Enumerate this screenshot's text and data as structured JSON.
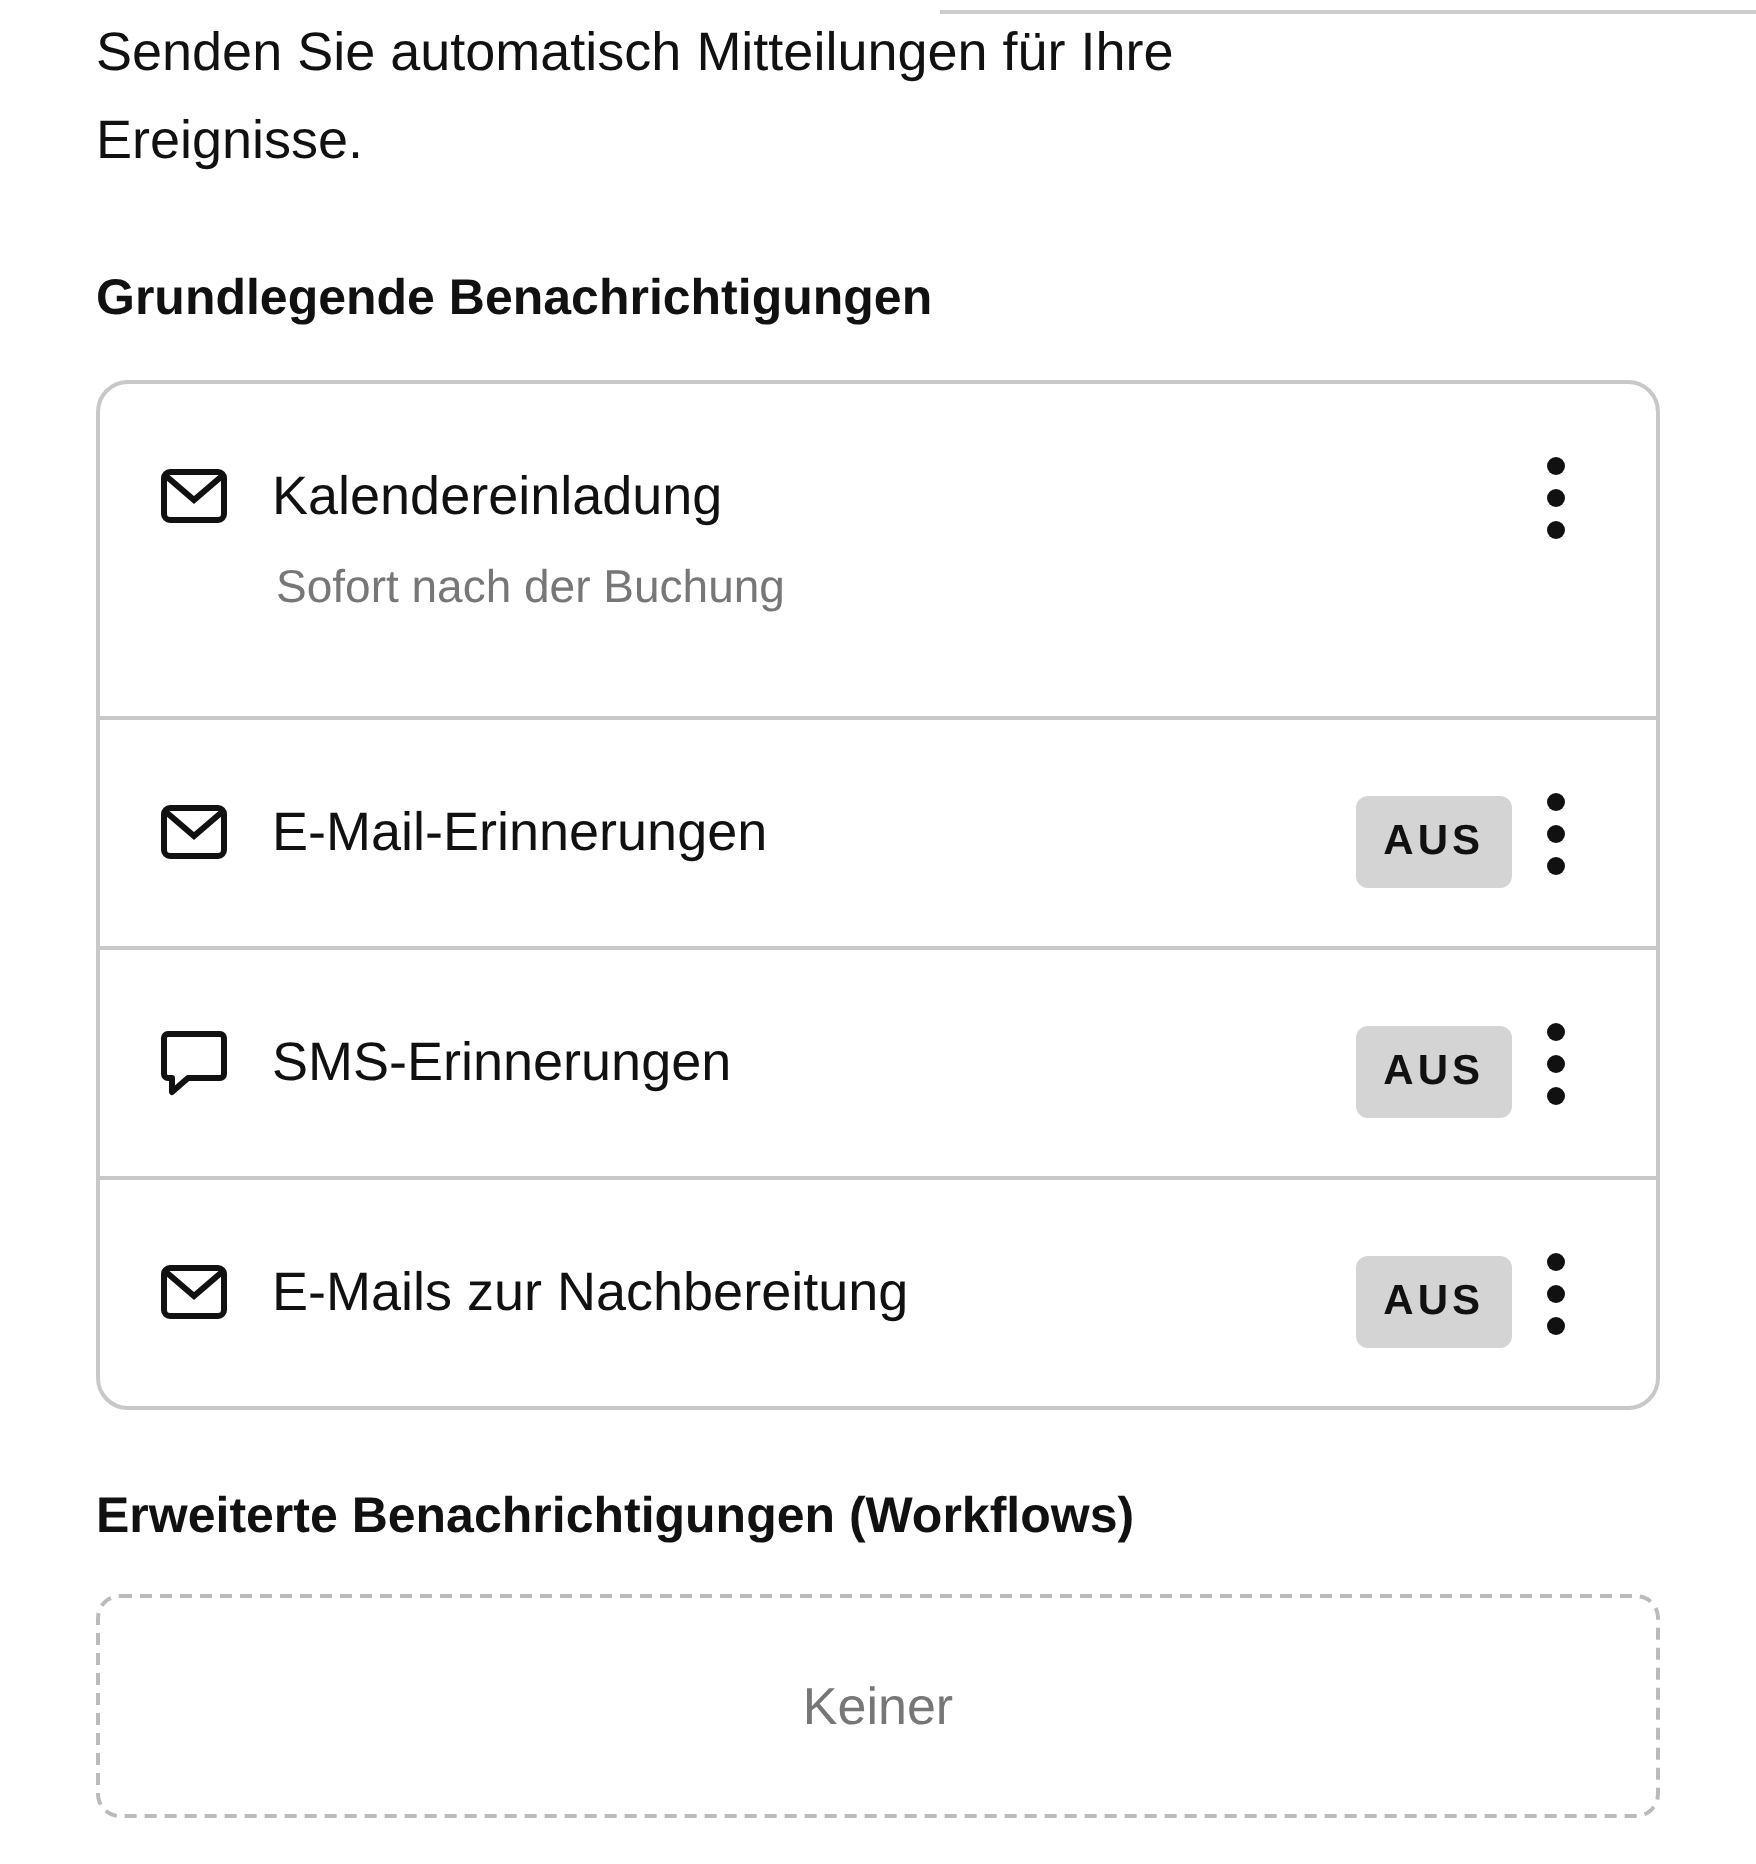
{
  "intro": "Senden Sie automatisch Mitteilungen für Ihre Ereignisse.",
  "basic": {
    "heading": "Grundlegende Benachrichtigungen",
    "items": [
      {
        "kind": "mail",
        "title": "Kalendereinladung",
        "subtitle": "Sofort nach der Buchung"
      },
      {
        "kind": "mail",
        "title": "E-Mail-Erinnerungen",
        "status": "AUS"
      },
      {
        "kind": "chat",
        "title": "SMS-Erinnerungen",
        "status": "AUS"
      },
      {
        "kind": "mail",
        "title": "E-Mails zur Nachbereitung",
        "status": "AUS"
      }
    ]
  },
  "advanced": {
    "heading": "Erweiterte Benachrichtigungen (Workflows)",
    "empty": "Keiner"
  }
}
